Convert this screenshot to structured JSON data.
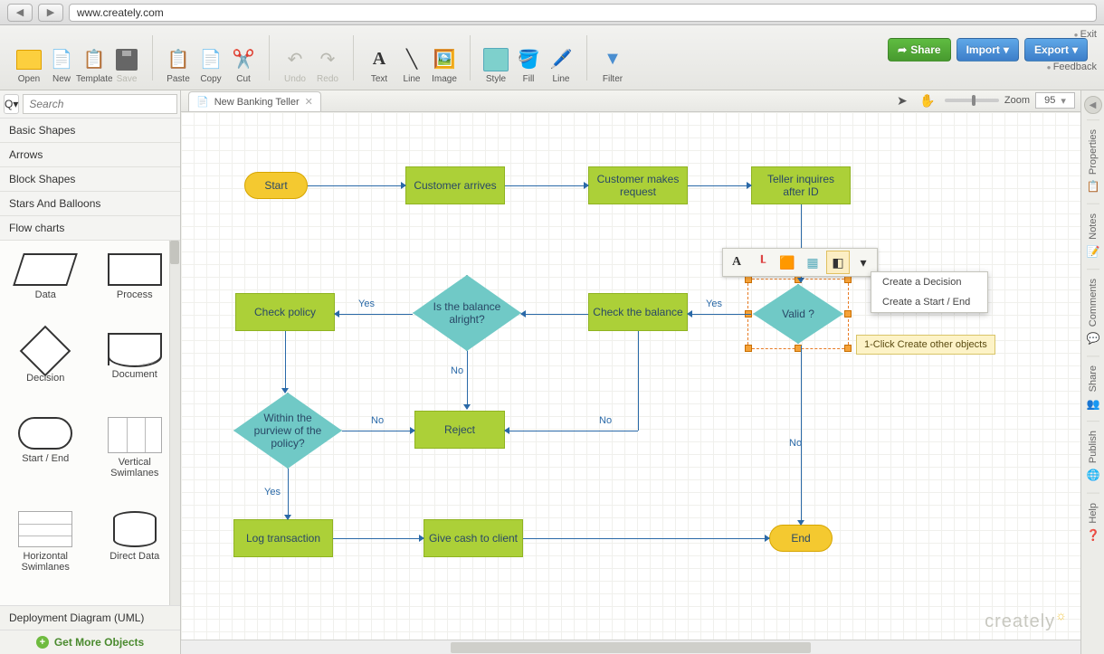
{
  "browser": {
    "url": "www.creately.com"
  },
  "toolbar": {
    "open": "Open",
    "new": "New",
    "template": "Template",
    "save": "Save",
    "paste": "Paste",
    "copy": "Copy",
    "cut": "Cut",
    "undo": "Undo",
    "redo": "Redo",
    "text": "Text",
    "line": "Line",
    "image": "Image",
    "style": "Style",
    "fill": "Fill",
    "line2": "Line",
    "filter": "Filter"
  },
  "buttons": {
    "share": "Share",
    "import": "Import",
    "export": "Export"
  },
  "links": {
    "exit": "Exit",
    "feedback": "Feedback"
  },
  "search": {
    "placeholder": "Search"
  },
  "categories": [
    "Basic Shapes",
    "Arrows",
    "Block Shapes",
    "Stars And Balloons",
    "Flow charts"
  ],
  "shapes": {
    "data": "Data",
    "process": "Process",
    "decision": "Decision",
    "document": "Document",
    "startend": "Start / End",
    "vswim": "Vertical Swimlanes",
    "hswim": "Horizontal Swimlanes",
    "direct": "Direct Data"
  },
  "leftFooter1": "Deployment Diagram (UML)",
  "leftFooter2": "Get More Objects",
  "tab": {
    "title": "New Banking Teller",
    "zoomLabel": "Zoom",
    "zoomValue": "95"
  },
  "flow": {
    "start": "Start",
    "customerArrives": "Customer arrives",
    "customerMakes": "Customer makes request",
    "tellerInquires": "Teller inquires after ID",
    "valid": "Valid ?",
    "checkBalance": "Check the balance",
    "isBalance": "Is the balance alright?",
    "checkPolicy": "Check policy",
    "withinPolicy": "Within the purview of the policy?",
    "reject": "Reject",
    "logTransaction": "Log transaction",
    "giveCash": "Give cash to client",
    "end": "End",
    "yes": "Yes",
    "no": "No"
  },
  "contextMenu": {
    "decision": "Create a Decision",
    "startend": "Create a Start / End"
  },
  "tooltip": "1-Click Create other objects",
  "rightTabs": {
    "properties": "Properties",
    "notes": "Notes",
    "comments": "Comments",
    "share": "Share",
    "publish": "Publish",
    "help": "Help"
  },
  "watermark": "creately"
}
